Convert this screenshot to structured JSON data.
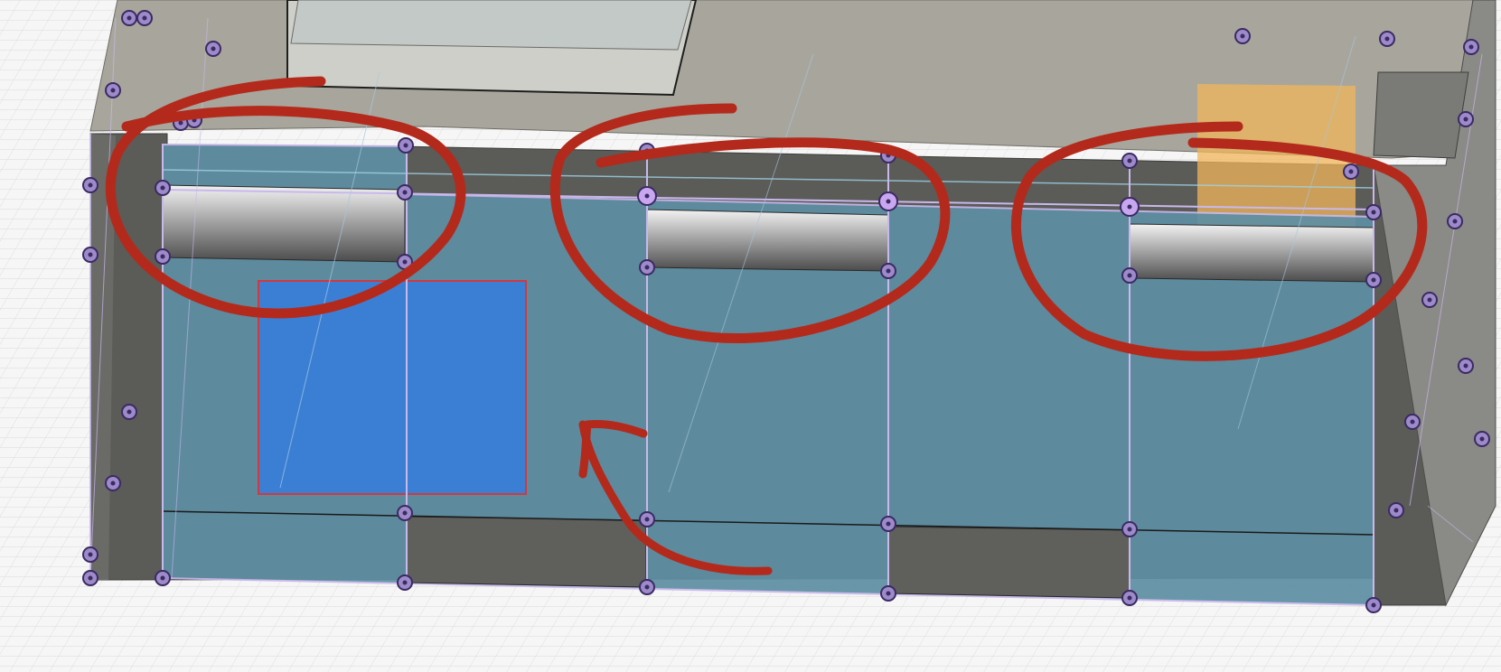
{
  "viewport": {
    "mode": "sketch-edit",
    "background_color": "#f6f6f6",
    "grid_color": "#d9d9d9"
  },
  "colors": {
    "sketch_profile": "#5e8fa3",
    "selected_profile": "#3a7fd8",
    "selection_outline": "#d9343a",
    "body_top": "#a8a69c",
    "body_front": "#8a8a86",
    "body_dark": "#5b5b58",
    "sketch_line": "#c9b8ec",
    "sketch_point": "#3b2a63",
    "point_ring": "#9c8ac9",
    "markup": "#b32a1c",
    "highlight_face": "#f0b65a"
  },
  "markup": {
    "circle_count": 3,
    "arrow_count": 1,
    "tool": "freehand-pen"
  },
  "icons": {
    "sketch_point": "point-icon",
    "arrow": "arrow-icon"
  }
}
